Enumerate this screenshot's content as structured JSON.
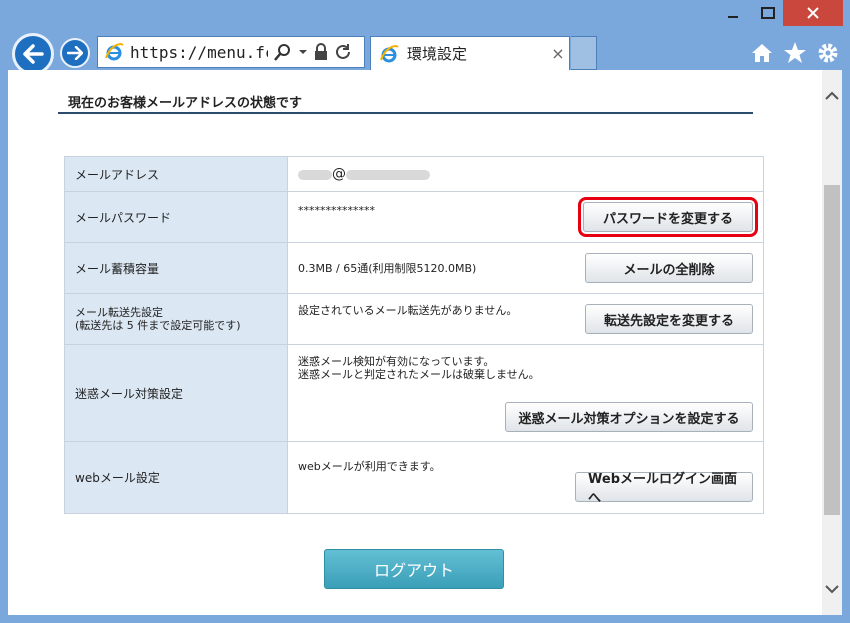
{
  "browser": {
    "url": "https://menu.fc...",
    "tab_title": "環境設定",
    "tab_close": "×"
  },
  "page": {
    "section_title": "現在のお客様メールアドレスの状態です",
    "rows": [
      {
        "label": "メールアドレス",
        "value": "@",
        "button": ""
      },
      {
        "label": "メールパスワード",
        "value": "**************",
        "button": "パスワードを変更する"
      },
      {
        "label": "メール蓄積容量",
        "value": "0.3MB / 65通(利用制限5120.0MB)",
        "button": "メールの全削除"
      },
      {
        "label": "メール転送先設定\n(転送先は 5 件まで設定可能です)",
        "label_line1": "メール転送先設定",
        "label_line2": "(転送先は 5 件まで設定可能です)",
        "value": "設定されているメール転送先がありません。",
        "button": "転送先設定を変更する"
      },
      {
        "label": "迷惑メール対策設定",
        "value_line1": "迷惑メール検知が有効になっています。",
        "value_line2": "迷惑メールと判定されたメールは破棄しません。",
        "button": "迷惑メール対策オプションを設定する"
      },
      {
        "label": "webメール設定",
        "value": "webメールが利用できます。",
        "button": "Webメールログイン画面へ"
      }
    ],
    "logout": "ログアウト"
  },
  "colors": {
    "highlight": "#e60012",
    "label_bg": "#dbe7f3",
    "logout_bg": "#4aaec5"
  }
}
